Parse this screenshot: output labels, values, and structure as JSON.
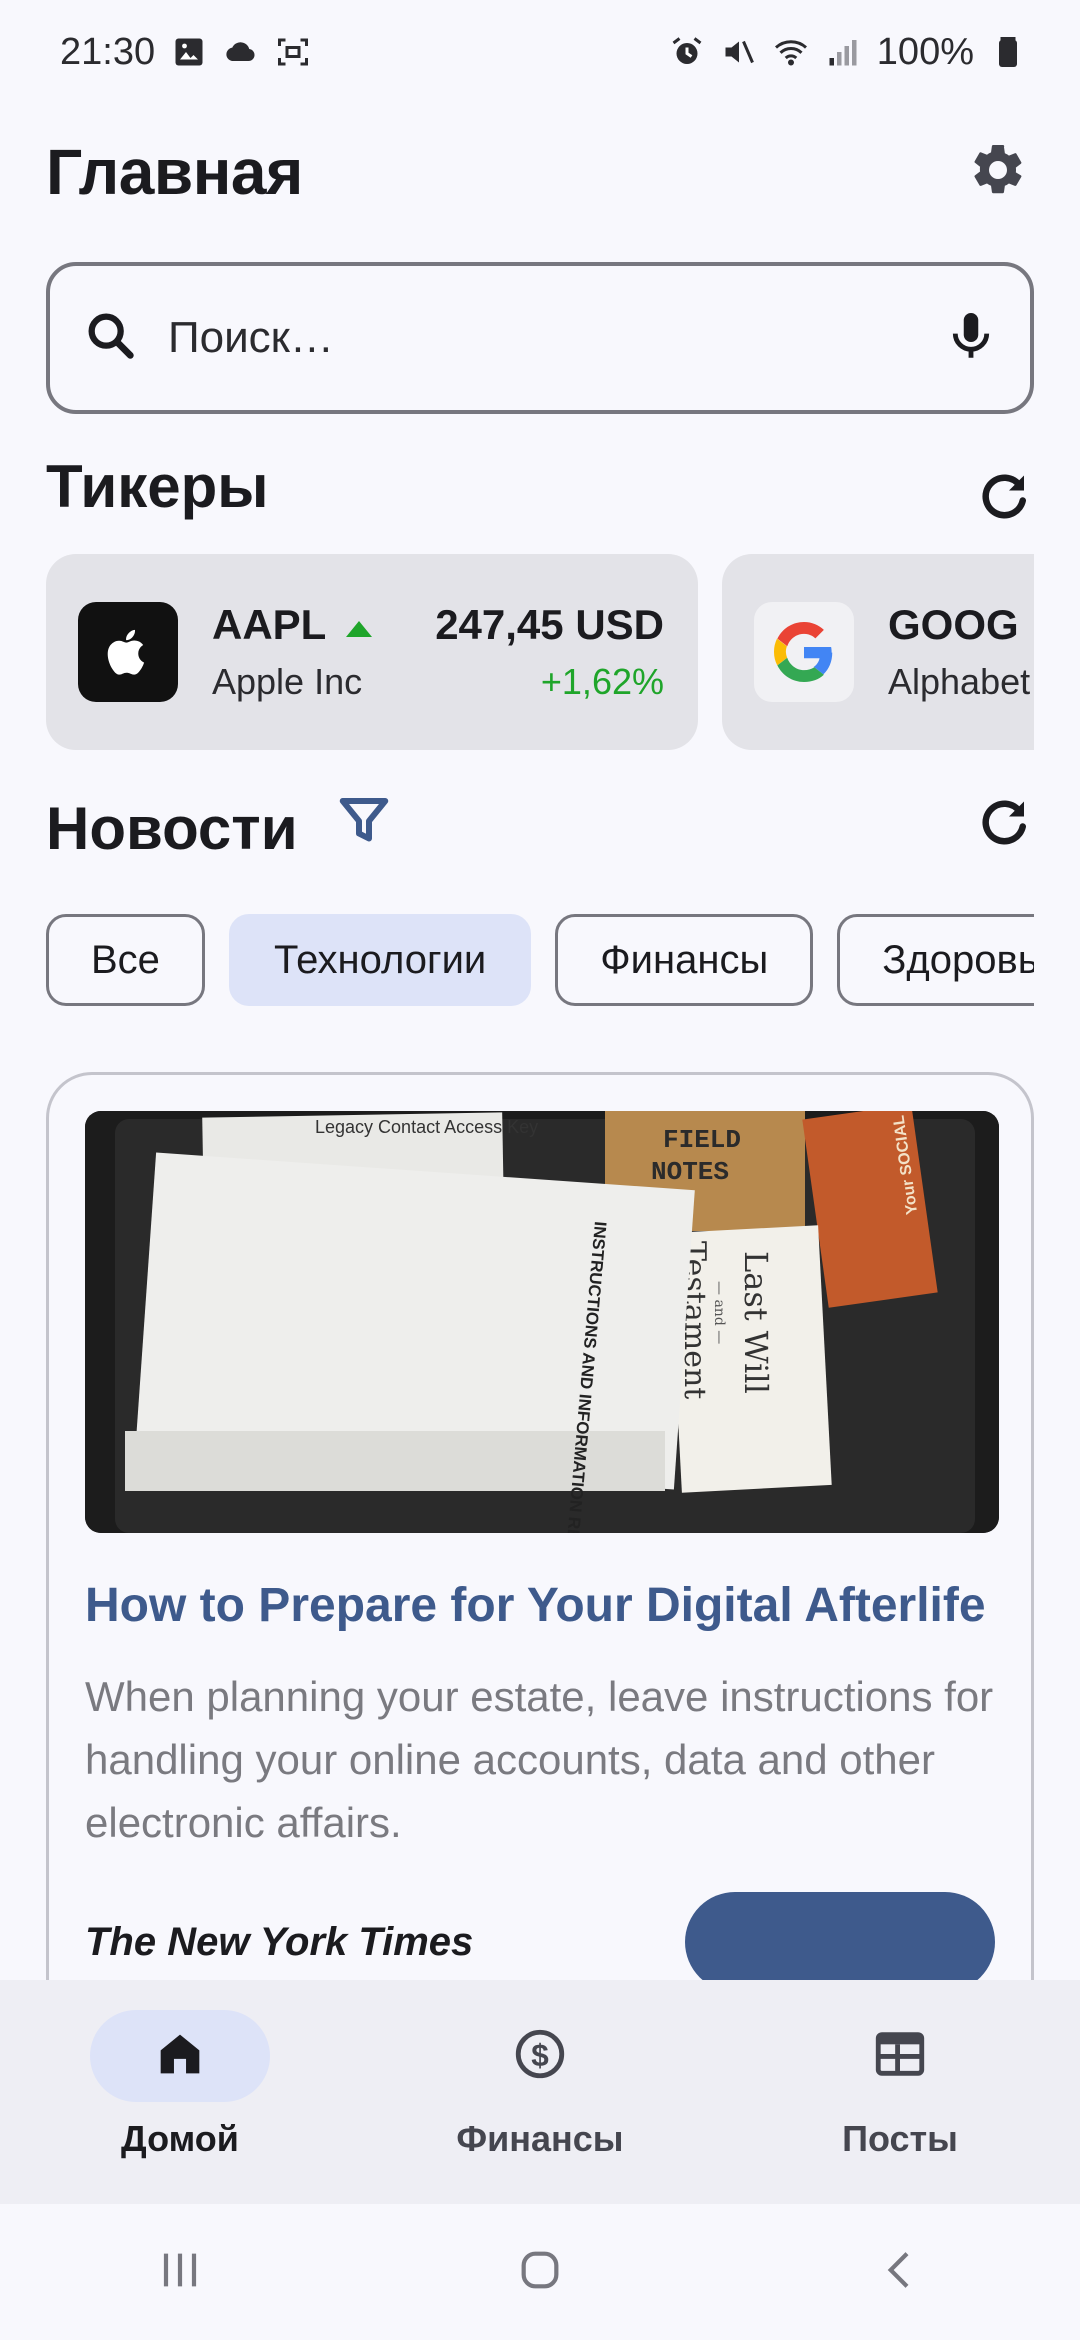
{
  "status_bar": {
    "time": "21:30",
    "battery": "100%",
    "left_icons": [
      "image-icon",
      "cloud-icon",
      "screenshot-icon"
    ],
    "right_icons": [
      "alarm-icon",
      "mute-icon",
      "wifi-icon",
      "signal-icon",
      "battery-icon"
    ]
  },
  "header": {
    "title": "Главная",
    "settings_icon": "gear-icon"
  },
  "search": {
    "placeholder": "Поиск…",
    "value": "",
    "search_icon": "search-icon",
    "mic_icon": "mic-icon"
  },
  "tickers": {
    "title": "Тикеры",
    "refresh_icon": "refresh-icon",
    "items": [
      {
        "symbol": "AAPL",
        "name": "Apple Inc",
        "price": "247,45 USD",
        "change": "+1,62%",
        "trend": "up",
        "trend_color": "#1fa52a",
        "logo": "apple-logo-icon"
      },
      {
        "symbol": "GOOG",
        "name": "Alphabet",
        "trend": "down",
        "trend_color": "#e53935",
        "logo": "google-logo-icon"
      }
    ]
  },
  "news": {
    "title": "Новости",
    "filter_icon": "filter-icon",
    "refresh_icon": "refresh-icon",
    "chips": [
      {
        "label": "Все",
        "selected": false
      },
      {
        "label": "Технологии",
        "selected": true
      },
      {
        "label": "Финансы",
        "selected": false
      },
      {
        "label": "Здоровье",
        "selected": false
      }
    ],
    "articles": [
      {
        "title": "How to Prepare for Your Digital Afterlife",
        "description": "When planning your estate, leave instructions for handling your online accounts, data and other electronic affairs.",
        "source": "The New York Times",
        "image": {
          "paper_main": "INSTRUCTIONS AND INFORMATION REGARDING MY DIGITAL ASSETS AND ONLINE ACCOUNTS",
          "paper_top": "Legacy Contact Access Key",
          "notebook_line1": "FIELD",
          "notebook_line2": "NOTES",
          "card_text": "Your SOCIAL SECURITY ACCOUNT CARD",
          "will_text_1": "Last Will",
          "will_text_2": "— and —",
          "will_text_3": "Testament"
        }
      }
    ]
  },
  "bottom_nav": {
    "items": [
      {
        "label": "Домой",
        "icon": "home-icon",
        "active": true
      },
      {
        "label": "Финансы",
        "icon": "dollar-icon",
        "active": false
      },
      {
        "label": "Посты",
        "icon": "newspaper-icon",
        "active": false
      }
    ]
  },
  "system_nav": {
    "buttons": [
      "recents-icon",
      "home-circle-icon",
      "back-icon"
    ]
  },
  "colors": {
    "accent": "#3e5a8c",
    "selected_chip": "#dde3f8",
    "positive": "#1fa52a",
    "negative": "#e53935"
  }
}
